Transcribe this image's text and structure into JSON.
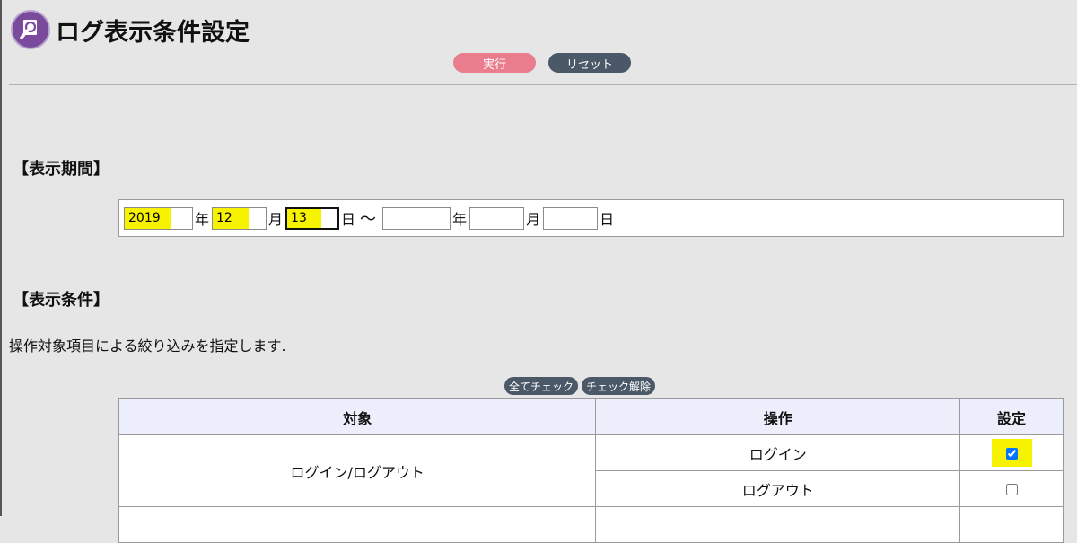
{
  "header": {
    "title": "ログ表示条件設定",
    "icon": "magnifier-log-icon",
    "icon_color": "#7a4a9c"
  },
  "actions": {
    "execute_label": "実行",
    "reset_label": "リセット",
    "execute_color": "#e97d8e",
    "reset_color": "#4a5868"
  },
  "period": {
    "section_title": "【表示期間】",
    "start": {
      "year": "2019",
      "month": "12",
      "day": "13"
    },
    "end": {
      "year": "",
      "month": "",
      "day": ""
    },
    "year_unit": "年",
    "month_unit": "月",
    "day_unit": "日",
    "separator": "～"
  },
  "conditions": {
    "section_title": "【表示条件】",
    "description": "操作対象項目による絞り込みを指定します.",
    "check_all_label": "全てチェック",
    "uncheck_all_label": "チェック解除",
    "columns": [
      "対象",
      "操作",
      "設定"
    ],
    "rows": [
      {
        "target": "ログイン/ログアウト",
        "operations": [
          {
            "name": "ログイン",
            "checked": true
          },
          {
            "name": "ログアウト",
            "checked": false
          }
        ]
      }
    ]
  },
  "highlight_color": "#f7f200"
}
